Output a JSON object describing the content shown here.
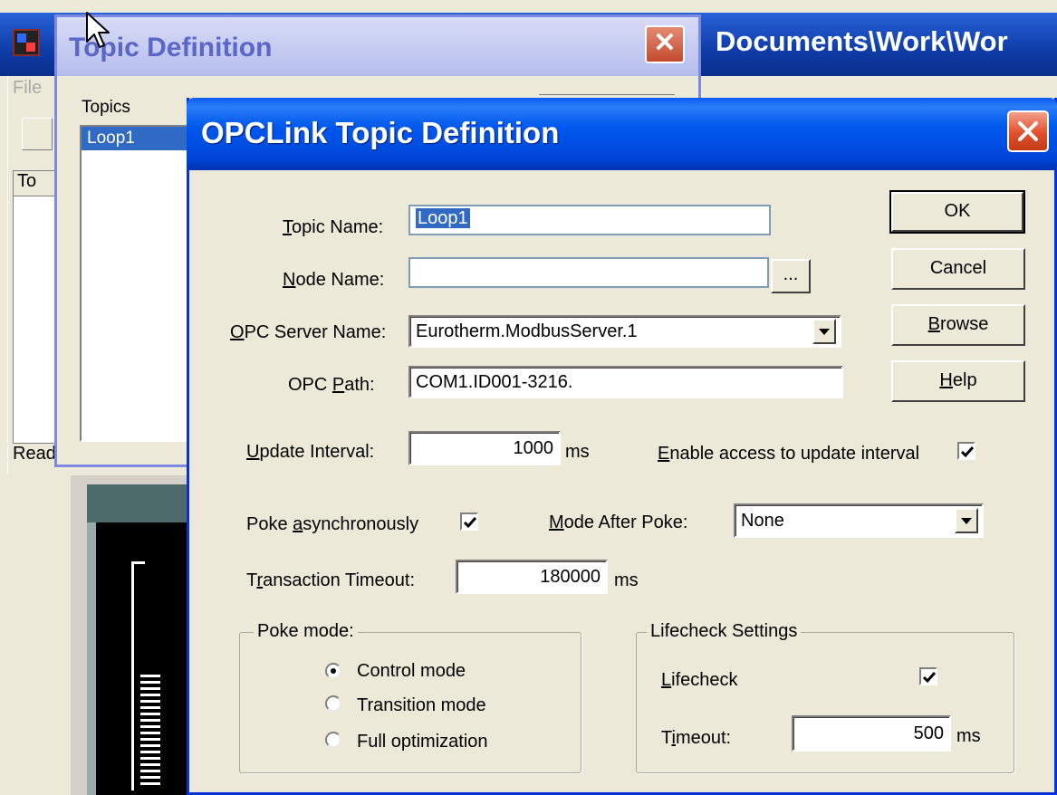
{
  "background_app": {
    "title": "Documents\\Work\\Wor",
    "menu_file": "File",
    "list_header": "To",
    "status": "Ready"
  },
  "topic_window": {
    "title": "Topic Definition",
    "close_glyph": "✕",
    "topics_label": "Topics",
    "topics": [
      "Loop1"
    ]
  },
  "dialog": {
    "title": "OPCLink Topic Definition",
    "fields": {
      "topic_name": {
        "label_u": "T",
        "label_rest": "opic Name:",
        "value": "Loop1"
      },
      "node_name": {
        "label_u": "N",
        "label_rest": "ode Name:",
        "value": "",
        "browse_label": "..."
      },
      "opc_server_name": {
        "label_u": "O",
        "label_rest": "PC Server Name:",
        "value": "Eurotherm.ModbusServer.1"
      },
      "opc_path": {
        "label_pre": "OPC ",
        "label_u": "P",
        "label_rest": "ath:",
        "value": "COM1.ID001-3216."
      },
      "update_interval": {
        "label_u": "U",
        "label_rest": "pdate Interval:",
        "value": "1000",
        "unit": "ms"
      },
      "enable_access": {
        "label_u": "E",
        "label_rest": "nable access to update interval",
        "checked": true
      },
      "poke_async": {
        "label_pre": "Poke ",
        "label_u": "a",
        "label_rest": "synchronously",
        "checked": true
      },
      "mode_after_poke": {
        "label_u": "M",
        "label_rest": "ode After Poke:",
        "value": "None"
      },
      "transaction_timeout": {
        "label_pre": "T",
        "label_u": "r",
        "label_rest": "ansaction Timeout:",
        "value": "180000",
        "unit": "ms"
      }
    },
    "buttons": {
      "ok": "OK",
      "cancel": "Cancel",
      "browse_u": "B",
      "browse_rest": "rowse",
      "help_u": "H",
      "help_rest": "elp"
    },
    "poke_mode": {
      "title": "Poke mode:",
      "options": [
        {
          "label": "Control mode",
          "selected": true
        },
        {
          "label": "Transition mode",
          "selected": false
        },
        {
          "label": "Full optimization",
          "selected": false
        }
      ]
    },
    "lifecheck": {
      "title": "Lifecheck Settings",
      "lifecheck_u": "L",
      "lifecheck_rest": "ifecheck",
      "checked": true,
      "timeout_pre": "T",
      "timeout_u": "i",
      "timeout_rest": "meout:",
      "timeout_value": "500",
      "unit": "ms"
    }
  },
  "colors": {
    "titlebar_blue": "#0058EE",
    "face": "#ECE9D8",
    "selection": "#316AC5",
    "close_red": "#E1502E"
  }
}
